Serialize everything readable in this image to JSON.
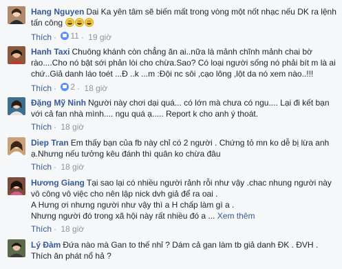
{
  "comments": [
    {
      "name": "Hang Nguyen",
      "text": "Dai Ka yên tâm sẽ biến mất trong vòng một nốt nhạc nếu DK ra lệnh tấn công",
      "emojis": [
        "grinning-emoji",
        "grinning-emoji",
        "grinning-emoji"
      ],
      "like_label": "Thích",
      "like_count": "11",
      "time": "19 giờ",
      "avatar_color": "#b08a6e"
    },
    {
      "name": "Hanh Taxi",
      "text": "Chuông khánh còn chẳng ăn ai..nữa là mảnh chĩnh mảnh chai bờ rào....Cho nó bật sới phản lòi cho chừa.Sao? Có loại người sống nó phải bít m là ai chứ..Giả danh láo toét ...Đ ..k ...m :Đội nc sôi ,cạo lông ,lột da nó xem nào..!!!",
      "like_label": "Thích",
      "like_count": "2",
      "time": "18 giờ",
      "avatar_color": "#8a5a3c"
    },
    {
      "name": "Đặng Mỹ Ninh",
      "text": "Người này chơi dại quá... có lớn mà chưa có ngu.... Lại đi kết bạn với cả fan nhà mình.... ngu quá ạ..... Report k cho anh ý thoát.",
      "like_label": "Thích",
      "like_count": "",
      "time": "18 giờ",
      "avatar_color": "#3d6f8e"
    },
    {
      "name": "Diep Tran",
      "text": "Em thấy bạn của fb này chỉ có 2 người . Chứng tỏ mn ko dễ bị lừa anh ạ.Nhưng nếu tưởng kêu đánh thì quân ko chừa đâu",
      "like_label": "Thích",
      "like_count": "",
      "time": "18 giờ",
      "avatar_color": "#c9a27c"
    },
    {
      "name": "Hương Giang",
      "text_lines": [
        "Tại sao lại có nhiều người rảnh rỗi như vậy .chac nhung người này vô công vô việc cho nên lập nick dvh giả để ra oai .",
        "A Hưng ơi nhưng người như vậy thì a H chấp làm gì a .",
        "Nhưng người đó trong xã hội này rất nhiều đó a ..."
      ],
      "more_label": "Xem thêm",
      "like_label": "Thích",
      "like_count": "",
      "time": "18 giờ",
      "avatar_color": "#7a4b3a"
    },
    {
      "name": "Lý Đàm",
      "text": "Đứa nào mà Gan to thế nhỉ ? Dám cả gan làm tb giả danh ĐK . ĐVH . Thích ăn phát nổ hả ?",
      "avatar_color": "#5b6b4a"
    }
  ]
}
